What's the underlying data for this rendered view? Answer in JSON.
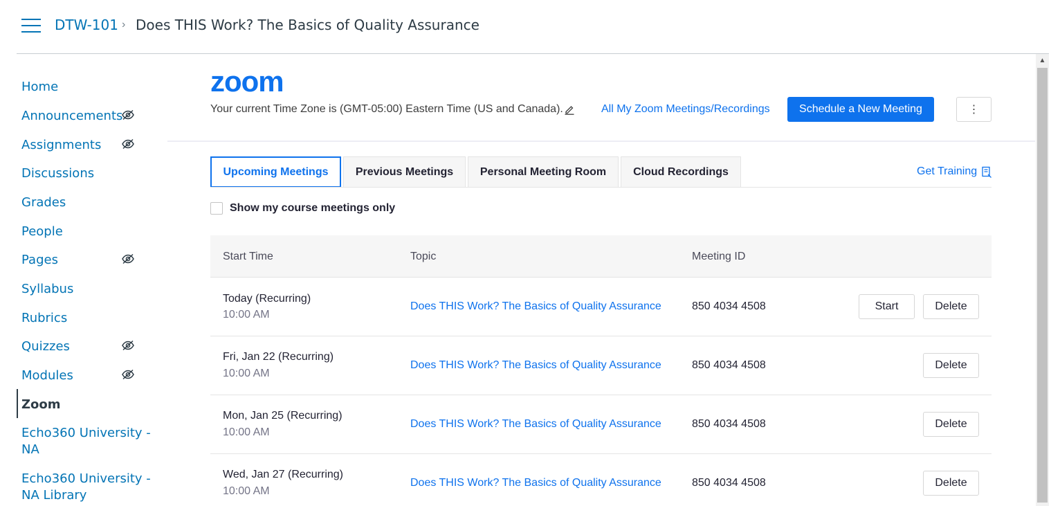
{
  "header": {
    "course_code": "DTW-101",
    "separator": "›",
    "page_title": "Does THIS Work? The Basics of Quality Assurance"
  },
  "sidebar": {
    "items": [
      {
        "label": "Home",
        "hidden": false
      },
      {
        "label": "Announcements",
        "hidden": true
      },
      {
        "label": "Assignments",
        "hidden": true
      },
      {
        "label": "Discussions",
        "hidden": false
      },
      {
        "label": "Grades",
        "hidden": false
      },
      {
        "label": "People",
        "hidden": false
      },
      {
        "label": "Pages",
        "hidden": true
      },
      {
        "label": "Syllabus",
        "hidden": false
      },
      {
        "label": "Rubrics",
        "hidden": false
      },
      {
        "label": "Quizzes",
        "hidden": true
      },
      {
        "label": "Modules",
        "hidden": true
      },
      {
        "label": "Zoom",
        "hidden": false,
        "active": true
      },
      {
        "label_line1": "Echo360 University -",
        "label_line2": "NA",
        "hidden": false
      },
      {
        "label_line1": "Echo360 University -",
        "label_line2": "NA Library",
        "hidden": false
      }
    ]
  },
  "zoom": {
    "logo_text": "zoom",
    "timezone_text": "Your current Time Zone is (GMT-05:00) Eastern Time (US and Canada).",
    "all_meetings_link": "All My Zoom Meetings/Recordings",
    "schedule_button": "Schedule a New Meeting",
    "more_button": "⋮",
    "accent_color": "#0e72ed"
  },
  "tabs": [
    {
      "label": "Upcoming Meetings",
      "active": true
    },
    {
      "label": "Previous Meetings",
      "active": false
    },
    {
      "label": "Personal Meeting Room",
      "active": false
    },
    {
      "label": "Cloud Recordings",
      "active": false
    }
  ],
  "get_training": "Get Training",
  "filter": {
    "label": "Show my course meetings only",
    "checked": false
  },
  "table": {
    "columns": [
      "Start Time",
      "Topic",
      "Meeting ID"
    ],
    "rows": [
      {
        "date": "Today (Recurring)",
        "time": "10:00 AM",
        "topic": "Does THIS Work? The Basics of Quality Assurance",
        "meeting_id": "850 4034 4508",
        "start_label": "Start",
        "delete_label": "Delete"
      },
      {
        "date": "Fri, Jan 22 (Recurring)",
        "time": "10:00 AM",
        "topic": "Does THIS Work? The Basics of Quality Assurance",
        "meeting_id": "850 4034 4508",
        "delete_label": "Delete"
      },
      {
        "date": "Mon, Jan 25 (Recurring)",
        "time": "10:00 AM",
        "topic": "Does THIS Work? The Basics of Quality Assurance",
        "meeting_id": "850 4034 4508",
        "delete_label": "Delete"
      },
      {
        "date": "Wed, Jan 27 (Recurring)",
        "time": "10:00 AM",
        "topic": "Does THIS Work? The Basics of Quality Assurance",
        "meeting_id": "850 4034 4508",
        "delete_label": "Delete"
      }
    ]
  }
}
